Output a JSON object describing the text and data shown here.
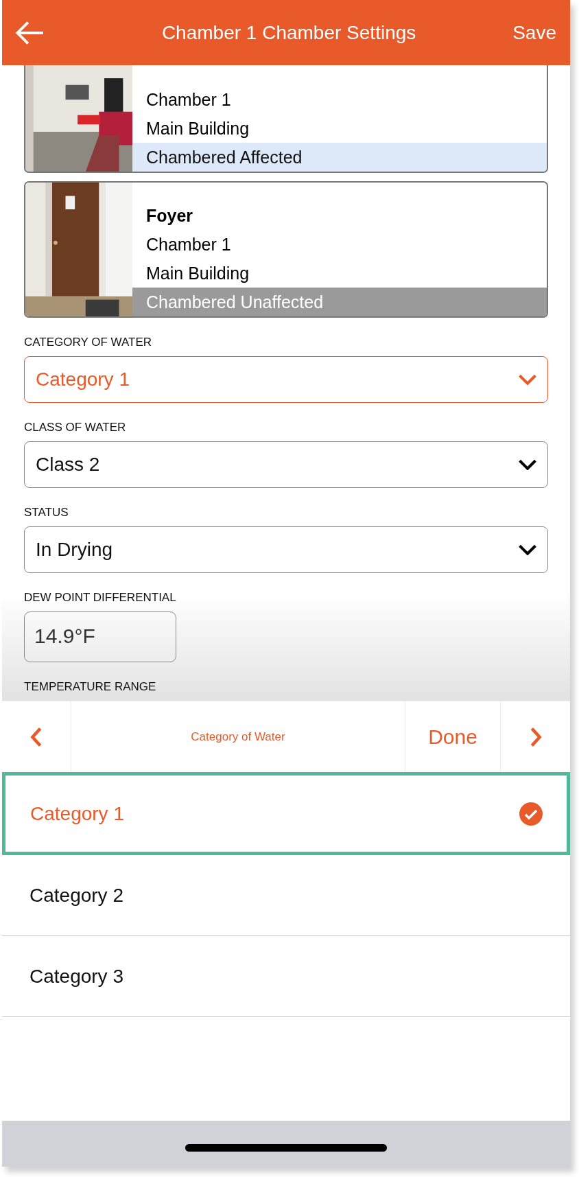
{
  "header": {
    "title": "Chamber 1 Chamber Settings",
    "action": "Save"
  },
  "rooms": [
    {
      "lines": [
        "Chamber 1",
        "Main Building"
      ],
      "status": "Chambered Affected",
      "affected": true
    },
    {
      "name": "Foyer",
      "lines": [
        "Chamber 1",
        "Main Building"
      ],
      "status": "Chambered Unaffected",
      "affected": false
    }
  ],
  "fields": [
    {
      "kind": "select",
      "label": "CATEGORY OF WATER",
      "value": "Category 1",
      "focused": true
    },
    {
      "kind": "select",
      "label": "CLASS OF WATER",
      "value": "Class 2",
      "focused": false
    },
    {
      "kind": "select",
      "label": "STATUS",
      "value": "In Drying",
      "focused": false
    },
    {
      "kind": "input",
      "label": "DEW POINT DIFFERENTIAL",
      "value": "14.9°F",
      "focused": false
    },
    {
      "kind": "label",
      "label": "TEMPERATURE RANGE"
    }
  ],
  "picker": {
    "title": "Category of Water",
    "done": "Done",
    "options": [
      {
        "label": "Category 1",
        "selected": true
      },
      {
        "label": "Category 2",
        "selected": false
      },
      {
        "label": "Category 3",
        "selected": false
      }
    ]
  }
}
